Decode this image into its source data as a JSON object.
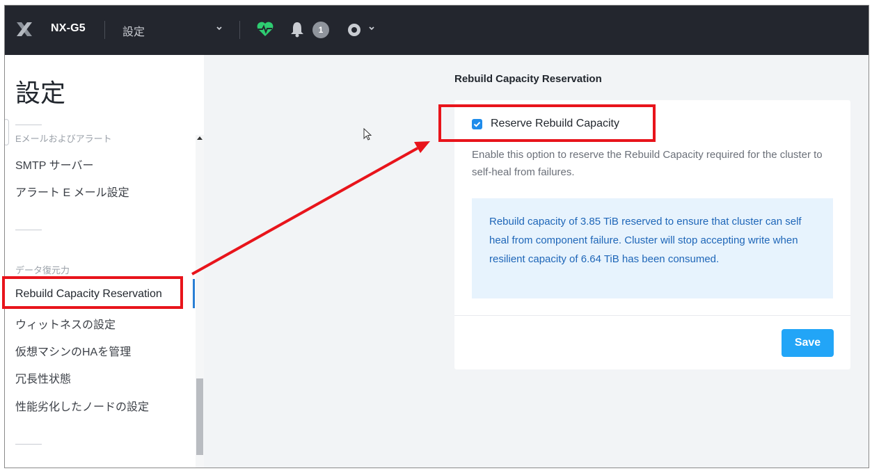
{
  "header": {
    "cluster_name": "NX-G5",
    "menu_label": "設定",
    "alert_count": "1",
    "icons": [
      "nutanix-logo-icon",
      "chevron-down-icon",
      "health-heart-icon",
      "bell-icon",
      "settings-icon"
    ]
  },
  "sidebar": {
    "title": "設定",
    "groups": [
      {
        "label": "Eメールおよびアラート",
        "items": [
          "SMTP サーバー",
          "アラート E メール設定"
        ]
      },
      {
        "label": "データ復元力",
        "items": [
          "Rebuild Capacity Reservation",
          "ウィットネスの設定",
          "仮想マシンのHAを管理",
          "冗長性状態",
          "性能劣化したノードの設定"
        ]
      }
    ],
    "active_item": "Rebuild Capacity Reservation"
  },
  "main": {
    "section_title": "Rebuild Capacity Reservation",
    "checkbox_label": "Reserve Rebuild Capacity",
    "checkbox_checked": true,
    "description": "Enable this option to reserve the Rebuild Capacity required for the cluster to self-heal from failures.",
    "info_text": "Rebuild capacity of 3.85 TiB reserved to ensure that cluster can self heal from component failure. Cluster will stop accepting write when resilient capacity of 6.64 TiB has been consumed.",
    "save_label": "Save"
  },
  "colors": {
    "header_bg": "#23262e",
    "accent": "#22a5f7",
    "health_green": "#2ecc71",
    "info_bg": "#e7f3fd",
    "info_text": "#1e66b8",
    "annotation_red": "#e8141b"
  }
}
